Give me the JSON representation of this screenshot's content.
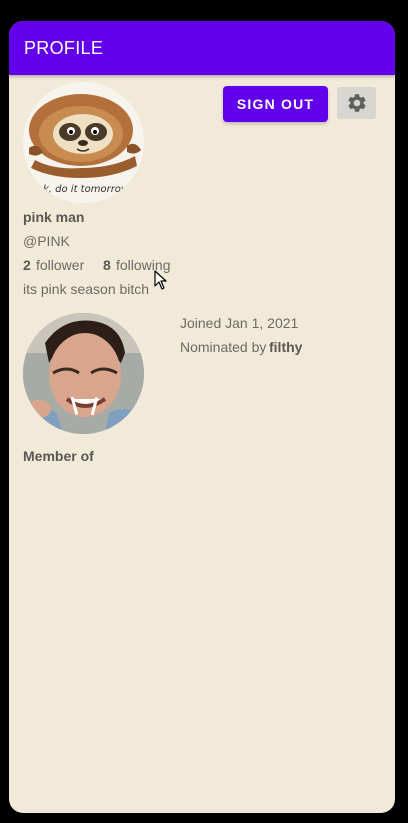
{
  "appbar": {
    "title": "PROFILE"
  },
  "actions": {
    "sign_out_label": "SIGN OUT",
    "settings_icon": "gear-icon"
  },
  "user": {
    "avatar_caption": "ok, do it tomorrow",
    "name": "pink man",
    "handle": "@PINK",
    "follower_count": "2",
    "follower_label": "follower",
    "following_count": "8",
    "following_label": "following",
    "bio": "its pink season bitch"
  },
  "membership": {
    "joined_text": "Joined Jan 1, 2021",
    "nominated_prefix": "Nominated by",
    "nominated_by": "filthy",
    "member_of_label": "Member of"
  },
  "colors": {
    "accent": "#6200ee",
    "background": "#f2ead8",
    "text": "#6d6a64"
  }
}
